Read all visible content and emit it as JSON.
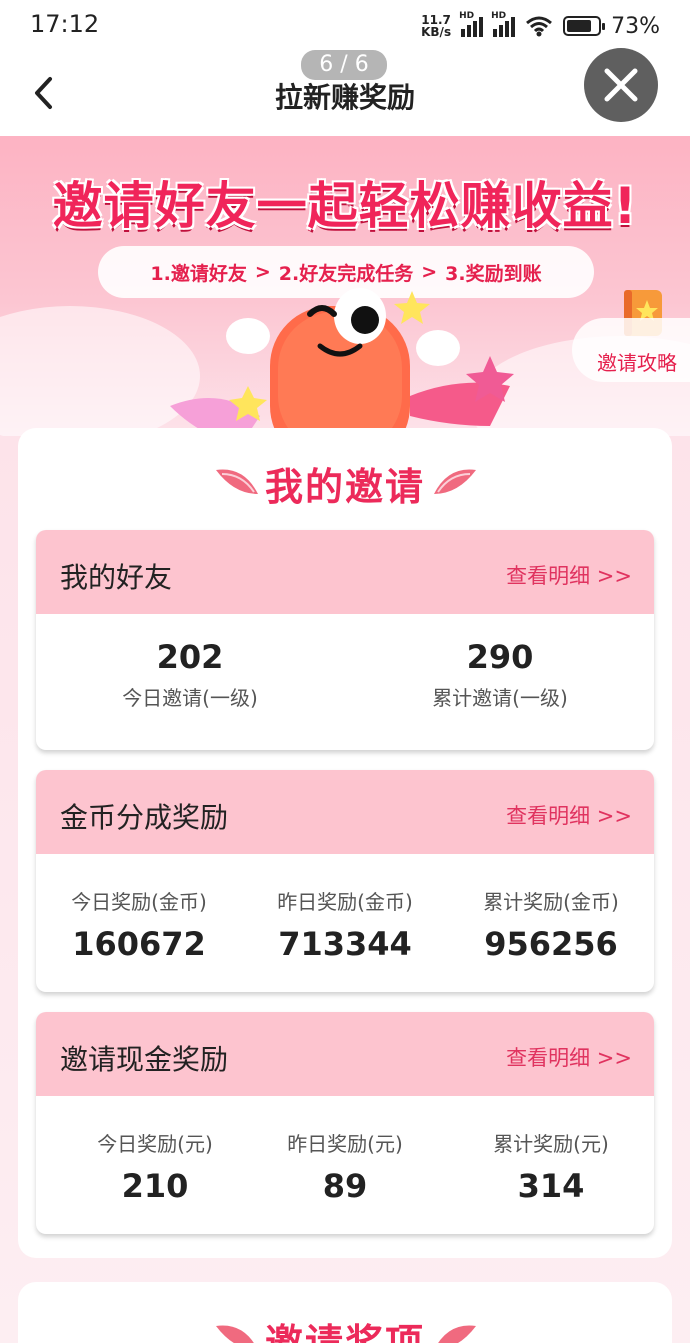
{
  "statusbar": {
    "time": "17:12",
    "net_speed_value": "11.7",
    "net_speed_unit": "KB/s",
    "hd1": "HD",
    "hd2": "HD",
    "battery_percent": "73%"
  },
  "header": {
    "page_counter": "6 / 6",
    "title": "拉新赚奖励"
  },
  "banner": {
    "headline": "邀请好友一起轻松赚收益!",
    "steps": [
      "1.邀请好友",
      "2.好友完成任务",
      "3.奖励到账"
    ],
    "step_separator": ">",
    "guide_label": "邀请攻略"
  },
  "my_invites": {
    "section_title": "我的邀请",
    "friends_card": {
      "title": "我的好友",
      "link": "查看明细 >>",
      "stats": [
        {
          "value": "202",
          "label": "今日邀请(一级)"
        },
        {
          "value": "290",
          "label": "累计邀请(一级)"
        }
      ]
    },
    "coin_card": {
      "title": "金币分成奖励",
      "link": "查看明细 >>",
      "stats": [
        {
          "label": "今日奖励(金币)",
          "value": "160672"
        },
        {
          "label": "昨日奖励(金币)",
          "value": "713344"
        },
        {
          "label": "累计奖励(金币)",
          "value": "956256"
        }
      ]
    },
    "cash_card": {
      "title": "邀请现金奖励",
      "link": "查看明细 >>",
      "stats": [
        {
          "label": "今日奖励(元)",
          "value": "210"
        },
        {
          "label": "昨日奖励(元)",
          "value": "89"
        },
        {
          "label": "累计奖励(元)",
          "value": "314"
        }
      ]
    }
  },
  "invite_prizes": {
    "section_title": "邀请奖项"
  },
  "colors": {
    "accent": "#ec2a5a",
    "card_header": "#fdc4cf",
    "banner_top": "#fdb3c3"
  }
}
